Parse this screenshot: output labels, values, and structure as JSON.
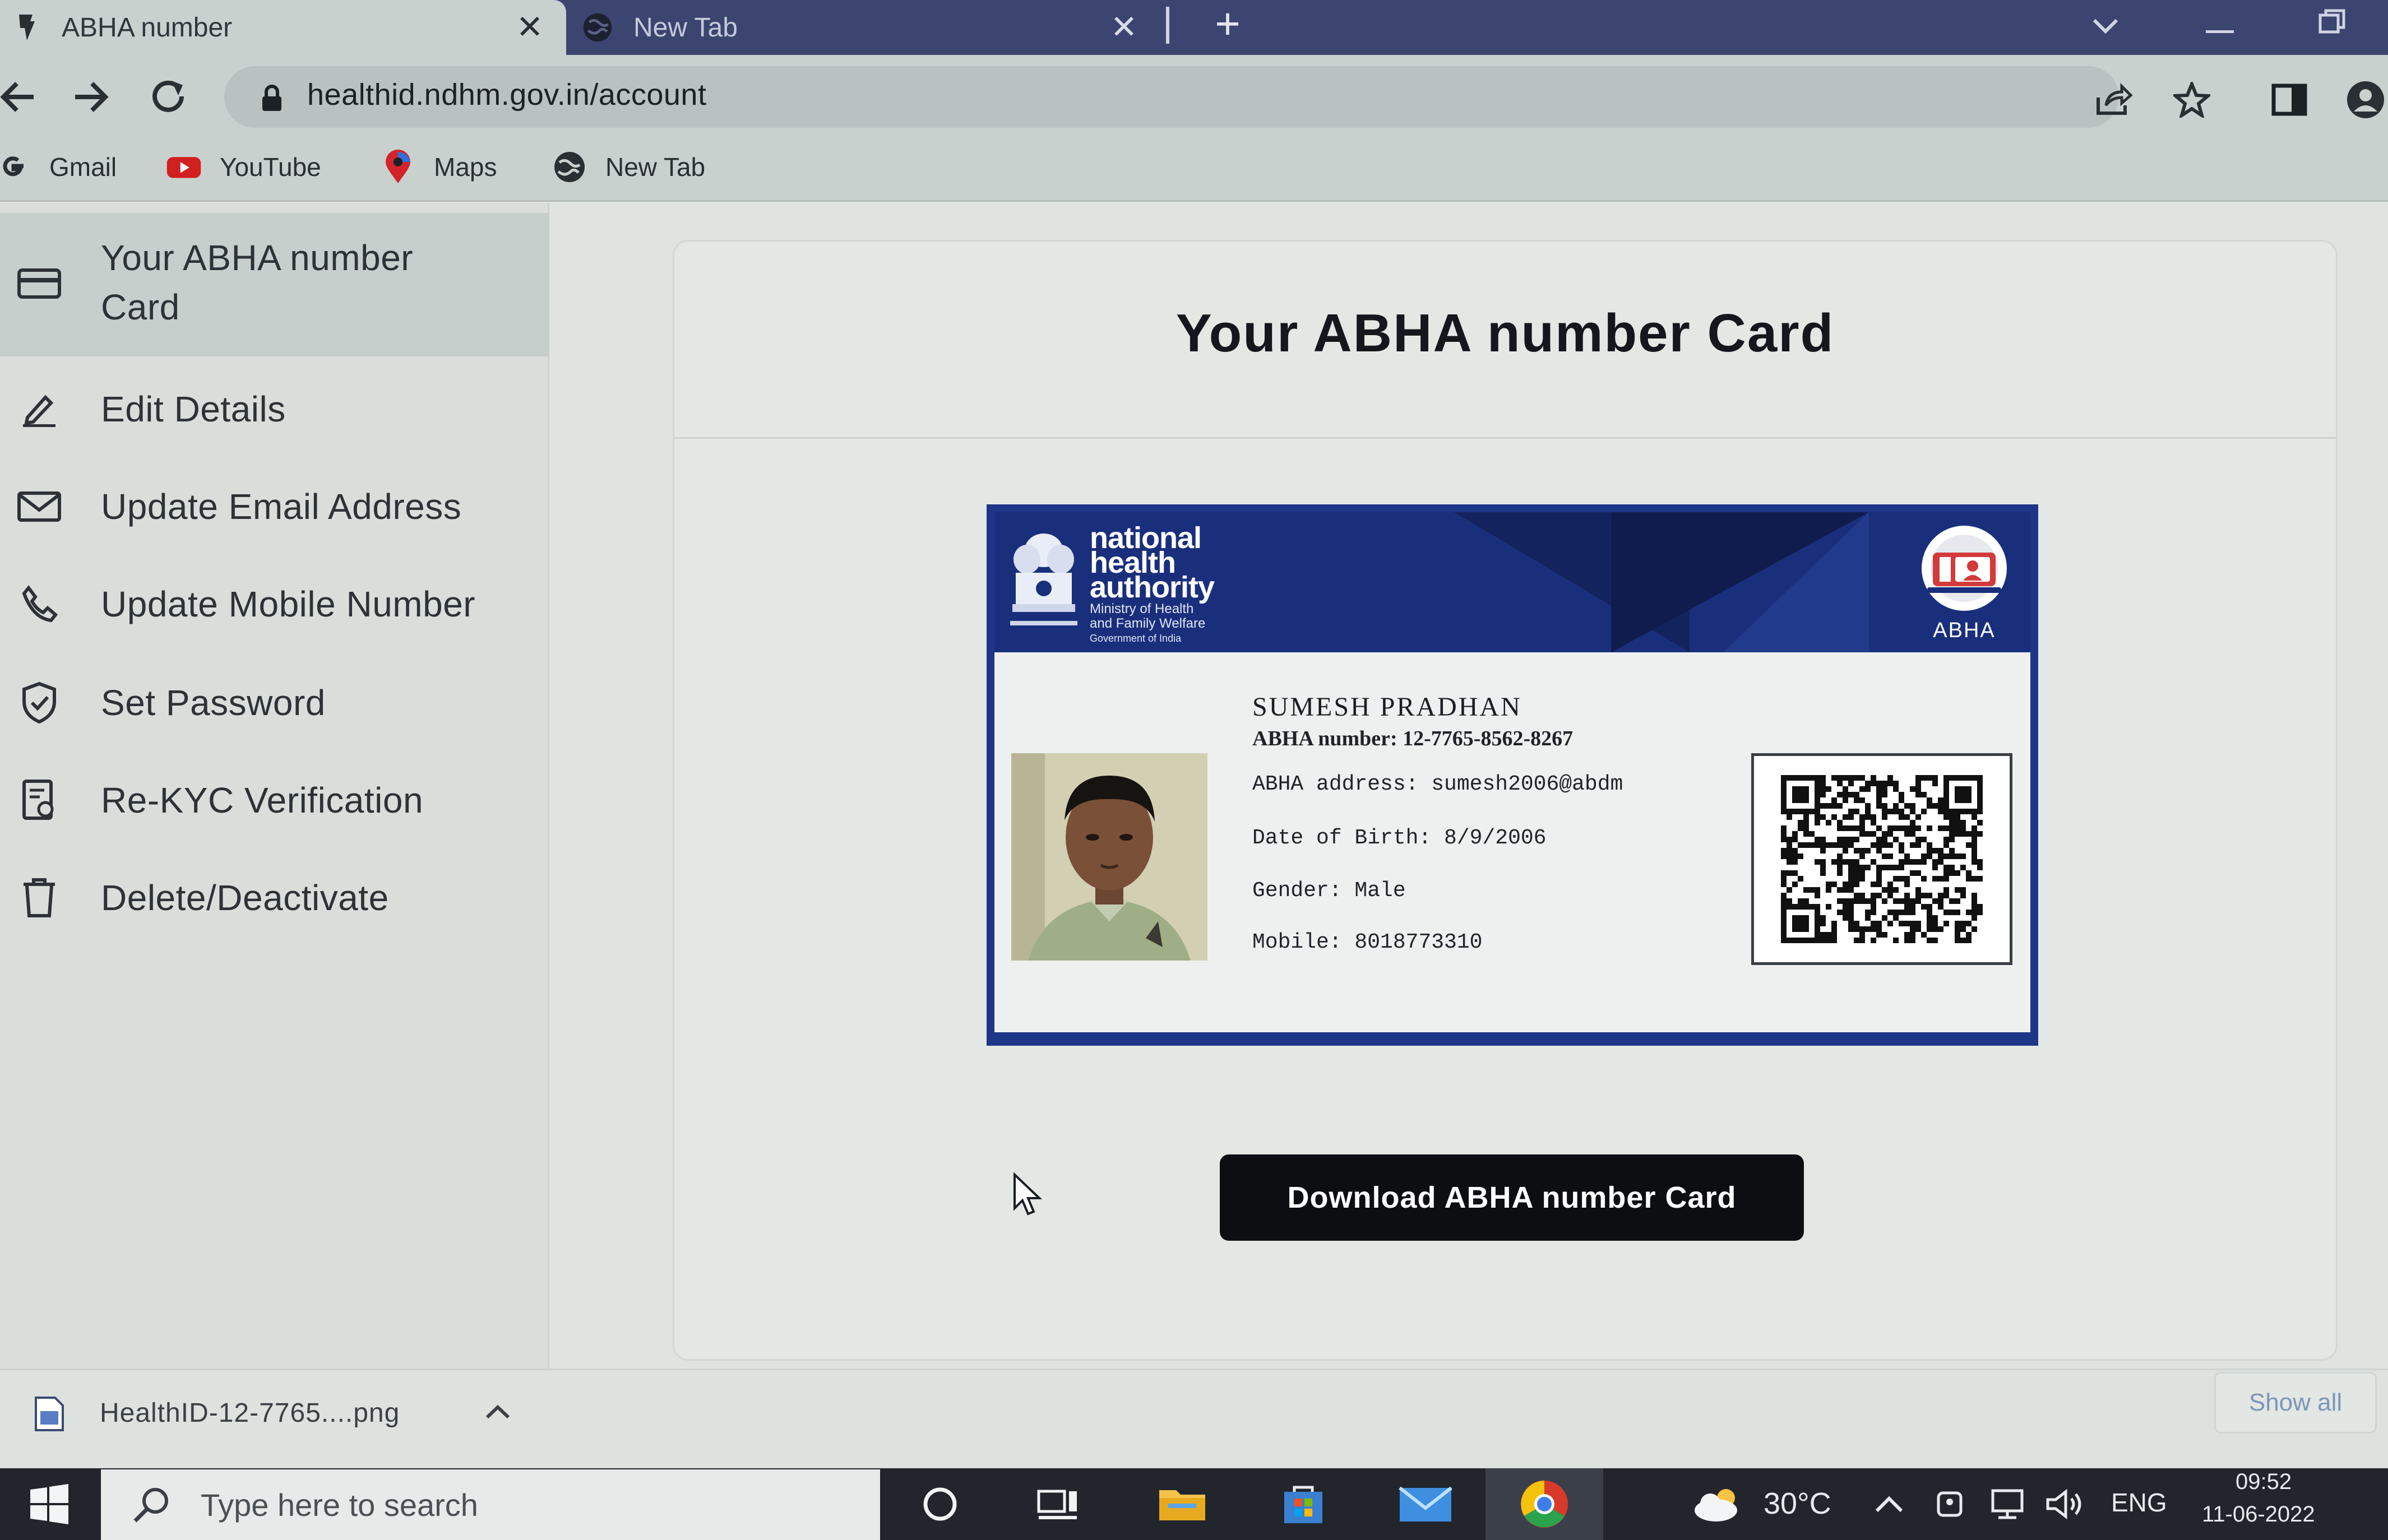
{
  "tabs": [
    {
      "title": "ABHA number",
      "close": "✕",
      "active": true
    },
    {
      "title": "New Tab",
      "close": "✕",
      "active": false
    }
  ],
  "new_tab_symbol": "+",
  "address_bar": {
    "url": "healthid.ndhm.gov.in/account"
  },
  "bookmarks": [
    {
      "label": "Gmail",
      "icon": "google-icon"
    },
    {
      "label": "YouTube",
      "icon": "youtube-icon"
    },
    {
      "label": "Maps",
      "icon": "maps-pin-icon"
    },
    {
      "label": "New Tab",
      "icon": "globe-icon"
    }
  ],
  "sidebar": {
    "items": [
      {
        "label": "Your ABHA number Card",
        "icon": "card-icon",
        "active": true
      },
      {
        "label": "Edit Details",
        "icon": "pencil-icon"
      },
      {
        "label": "Update Email Address",
        "icon": "envelope-icon"
      },
      {
        "label": "Update Mobile Number",
        "icon": "phone-icon"
      },
      {
        "label": "Set Password",
        "icon": "shield-check-icon"
      },
      {
        "label": "Re-KYC Verification",
        "icon": "kyc-document-icon"
      },
      {
        "label": "Delete/Deactivate",
        "icon": "trash-icon"
      }
    ]
  },
  "main": {
    "title": "Your ABHA number Card",
    "download_label": "Download ABHA number Card"
  },
  "card": {
    "org_line1": "national",
    "org_line2": "health",
    "org_line3": "authority",
    "ministry_line1": "Ministry of Health",
    "ministry_line2": "and Family Welfare",
    "ministry_line3": "Government of India",
    "logo_label": "ABHA",
    "name": "SUMESH PRADHAN",
    "abha_number": "ABHA number: 12-7765-8562-8267",
    "abha_address": "ABHA address: sumesh2006@abdm",
    "dob": "Date of Birth: 8/9/2006",
    "gender": "Gender: Male",
    "mobile": "Mobile: 8018773310",
    "colors": {
      "banner": "#1a2f7c",
      "border": "#1d3687"
    }
  },
  "download_shelf": {
    "file": "HealthID-12-7765....png",
    "show_all": "Show all"
  },
  "taskbar": {
    "search_placeholder": "Type here to search",
    "temperature": "30°C",
    "language": "ENG",
    "time": "09:52",
    "date": "11-06-2022"
  }
}
